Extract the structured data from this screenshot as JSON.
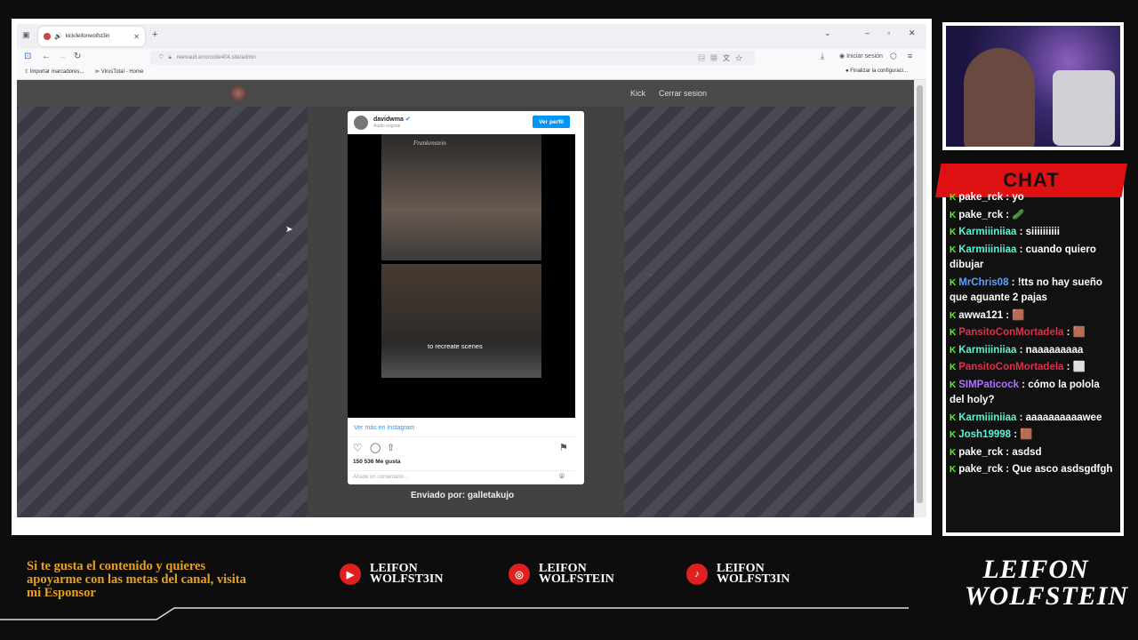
{
  "browser": {
    "tab_title": "kick/leifonwolfst3in",
    "new_tab": "+",
    "url": "reelvault.errorcode404.site/admin",
    "signin_label": "Iniciar sesión",
    "bookmarks": [
      "Importar marcadores...",
      "VirusTotal - Home"
    ],
    "config_notice": "Finalizar la configuraci..."
  },
  "site": {
    "nav_links": [
      "Kick",
      "Cerrar sesion"
    ],
    "post": {
      "username": "davidwma",
      "subtitle": "Audio original",
      "profile_button": "Ver perfil",
      "video_caption": "to recreate scenes",
      "watermark": "Frankenstein",
      "more_link": "Ver más en Instagram",
      "likes": "150 536 Me gusta",
      "comment_placeholder": "Añade un comentario..."
    },
    "sent_by": "Enviado por: galletakujo"
  },
  "chat": {
    "title": "CHAT",
    "messages": [
      {
        "user": "pake_rck",
        "color": "#ffffff",
        "text": ": yo"
      },
      {
        "user": "pake_rck",
        "color": "#ffffff",
        "text": ": 🥒"
      },
      {
        "user": "Karmiiiniiaa",
        "color": "#5ef2d0",
        "text": ": siiiiiiiiii"
      },
      {
        "user": "Karmiiiniiaa",
        "color": "#5ef2d0",
        "text": ": cuando quiero dibujar"
      },
      {
        "user": "MrChris08",
        "color": "#5aa0ff",
        "text": ": !tts no hay sueño que aguante 2 pajas"
      },
      {
        "user": "awwa121",
        "color": "#ffffff",
        "text": ": 🟫"
      },
      {
        "user": "PansitoConMortadela",
        "color": "#e0304a",
        "text": ": 🟫"
      },
      {
        "user": "Karmiiiniiaa",
        "color": "#5ef2d0",
        "text": ": naaaaaaaaa"
      },
      {
        "user": "PansitoConMortadela",
        "color": "#e0304a",
        "text": ": ⬜"
      },
      {
        "user": "SIMPaticock",
        "color": "#b070ff",
        "text": ": cómo la polola del holy?"
      },
      {
        "user": "Karmiiiniiaa",
        "color": "#5ef2d0",
        "text": ": aaaaaaaaaawee"
      },
      {
        "user": "Josh19998",
        "color": "#5ef2d0",
        "text": ": 🟫"
      },
      {
        "user": "pake_rck",
        "color": "#ffffff",
        "text": ": asdsd"
      },
      {
        "user": "pake_rck",
        "color": "#ffffff",
        "text": ": Que asco asdsgdfgh"
      }
    ]
  },
  "overlay": {
    "sponsor_text": "Si te gusta el contenido y quieres apoyarme con las metas del canal, visita mi Esponsor",
    "socials": [
      {
        "name_line1": "LEIFON",
        "name_line2": "WOLFST3IN",
        "icon": "youtube-icon"
      },
      {
        "name_line1": "LEIFON",
        "name_line2": "WOLFSTEIN",
        "icon": "instagram-icon"
      },
      {
        "name_line1": "LEIFON",
        "name_line2": "WOLFST3IN",
        "icon": "tiktok-icon"
      }
    ],
    "logo_line1": "LEIFON",
    "logo_line2": "WOLFSTEIN"
  }
}
